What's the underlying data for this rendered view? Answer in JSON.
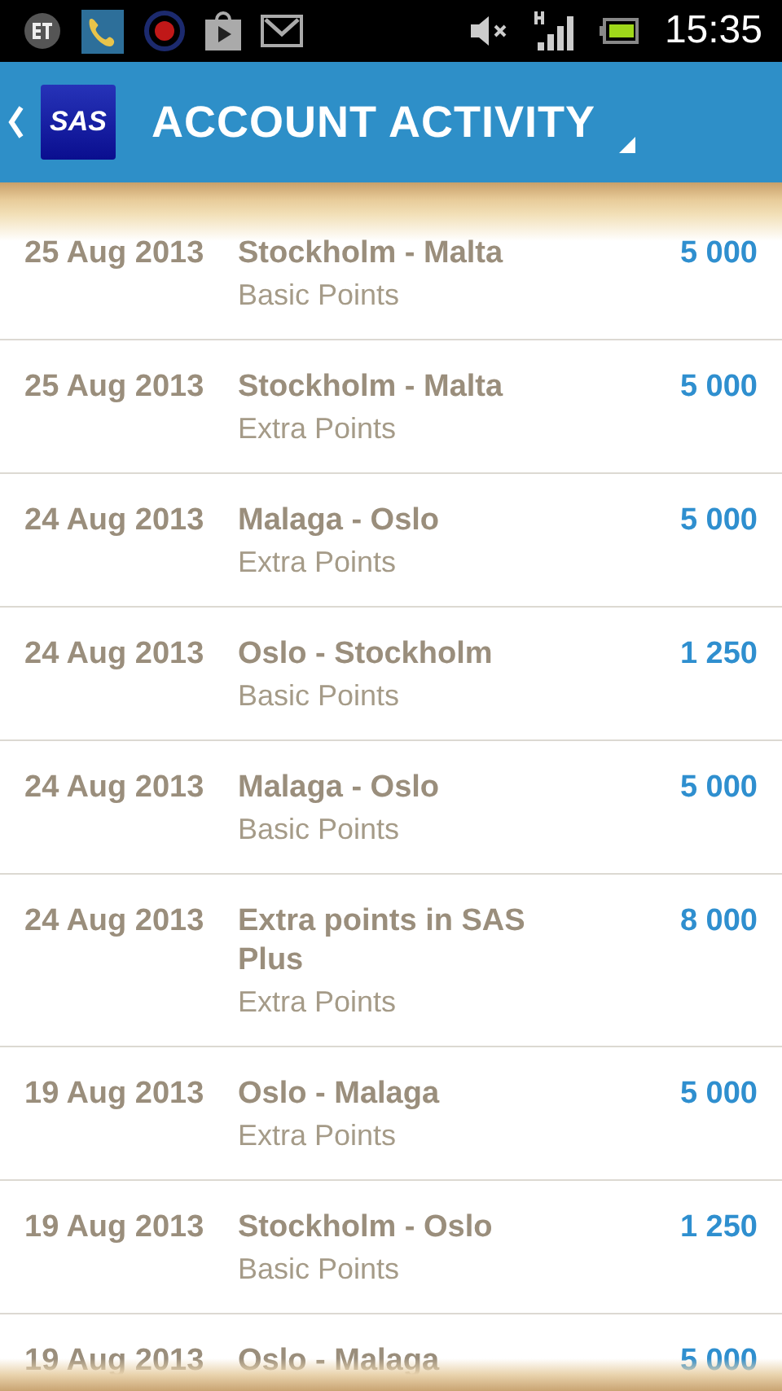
{
  "status_bar": {
    "time": "15:35"
  },
  "header": {
    "logo_text": "SAS",
    "title": "ACCOUNT ACTIVITY"
  },
  "entries": [
    {
      "date": "25 Aug 2013",
      "route": "Stockholm - Malta",
      "type": "Basic Points",
      "points": "5 000"
    },
    {
      "date": "25 Aug 2013",
      "route": "Stockholm - Malta",
      "type": "Extra Points",
      "points": "5 000"
    },
    {
      "date": "24 Aug 2013",
      "route": "Malaga - Oslo",
      "type": "Extra Points",
      "points": "5 000"
    },
    {
      "date": "24 Aug 2013",
      "route": "Oslo - Stockholm",
      "type": "Basic Points",
      "points": "1 250"
    },
    {
      "date": "24 Aug 2013",
      "route": "Malaga - Oslo",
      "type": "Basic Points",
      "points": "5 000"
    },
    {
      "date": "24 Aug 2013",
      "route": "Extra points in SAS Plus",
      "type": "Extra Points",
      "points": "8 000"
    },
    {
      "date": "19 Aug 2013",
      "route": "Oslo - Malaga",
      "type": "Extra Points",
      "points": "5 000"
    },
    {
      "date": "19 Aug 2013",
      "route": "Stockholm - Oslo",
      "type": "Basic Points",
      "points": "1 250"
    },
    {
      "date": "19 Aug 2013",
      "route": "Oslo - Malaga",
      "points": "5 000"
    }
  ]
}
